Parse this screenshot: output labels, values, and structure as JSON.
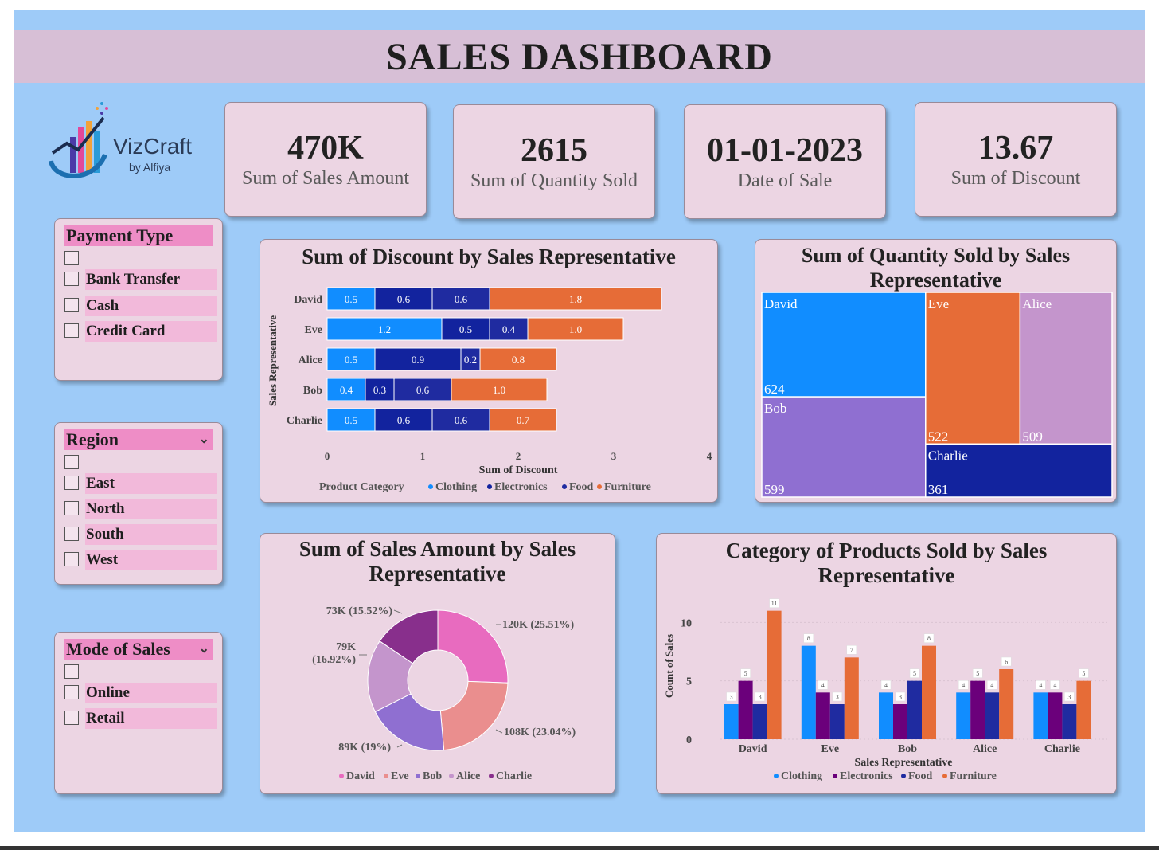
{
  "header": {
    "title": "SALES DASHBOARD"
  },
  "logo": {
    "name": "VizCraft",
    "byline": "by Alfiya"
  },
  "kpis": [
    {
      "value": "470K",
      "label": "Sum of Sales Amount"
    },
    {
      "value": "2615",
      "label": "Sum of Quantity Sold"
    },
    {
      "value": "01-01-2023",
      "label": "Date of Sale"
    },
    {
      "value": "13.67",
      "label": "Sum of Discount"
    }
  ],
  "slicers": {
    "payment": {
      "title": "Payment Type",
      "options": [
        "",
        "Bank Transfer",
        "Cash",
        "Credit Card"
      ]
    },
    "region": {
      "title": "Region",
      "options": [
        "",
        "East",
        "North",
        "South",
        "West"
      ]
    },
    "mode": {
      "title": "Mode of Sales",
      "options": [
        "",
        "Online",
        "Retail"
      ]
    }
  },
  "colors": {
    "clothing": "#118dff",
    "electronics": "#12239e",
    "food": "#1f2ba0",
    "furniture": "#e66c37",
    "bar_electronics": "#6b007b",
    "david": "#e86bbf",
    "eve": "#ea8e8e",
    "bob": "#8f6fd1",
    "alice": "#c495cc",
    "charlie": "#882f8c"
  },
  "chart_data": [
    {
      "type": "bar",
      "orientation": "horizontal",
      "stacked": true,
      "title": "Sum of Discount by Sales Representative",
      "xlabel": "Sum of Discount",
      "ylabel": "Sales Representative",
      "xlim": [
        0,
        4
      ],
      "xticks": [
        "0",
        "1",
        "2",
        "3",
        "4"
      ],
      "legend_title": "Product Category",
      "categories": [
        "David",
        "Eve",
        "Alice",
        "Bob",
        "Charlie"
      ],
      "series": [
        {
          "name": "Clothing",
          "values": [
            0.5,
            1.2,
            0.5,
            0.4,
            0.5
          ]
        },
        {
          "name": "Electronics",
          "values": [
            0.6,
            0.5,
            0.9,
            0.3,
            0.6
          ]
        },
        {
          "name": "Food",
          "values": [
            0.6,
            0.4,
            0.2,
            0.6,
            0.6
          ]
        },
        {
          "name": "Furniture",
          "values": [
            1.8,
            1.0,
            0.8,
            1.0,
            0.7
          ]
        }
      ]
    },
    {
      "type": "treemap",
      "title": "Sum of Quantity Sold by Sales Representative",
      "labels": [
        "David",
        "Bob",
        "Eve",
        "Alice",
        "Charlie"
      ],
      "values": [
        624,
        599,
        522,
        509,
        361
      ]
    },
    {
      "type": "pie",
      "donut": true,
      "title": "Sum of Sales Amount by Sales Representative",
      "labels": [
        "David",
        "Eve",
        "Bob",
        "Alice",
        "Charlie"
      ],
      "values": [
        120,
        108,
        89,
        79,
        73
      ],
      "slice_labels": [
        "120K (25.51%)",
        "108K (23.04%)",
        "89K (19%)",
        "79K (16.92%)",
        "73K (15.52%)"
      ]
    },
    {
      "type": "bar",
      "title": "Category of Products Sold by Sales Representative",
      "xlabel": "Sales Representative",
      "ylabel": "Count of Sales",
      "ylim": [
        0,
        12
      ],
      "yticks": [
        "0",
        "5",
        "10"
      ],
      "categories": [
        "David",
        "Eve",
        "Bob",
        "Alice",
        "Charlie"
      ],
      "series": [
        {
          "name": "Clothing",
          "values": [
            3,
            8,
            4,
            4,
            4
          ]
        },
        {
          "name": "Electronics",
          "values": [
            5,
            4,
            3,
            5,
            4
          ]
        },
        {
          "name": "Food",
          "values": [
            3,
            3,
            5,
            4,
            3
          ]
        },
        {
          "name": "Furniture",
          "values": [
            11,
            7,
            8,
            6,
            5
          ]
        }
      ]
    }
  ]
}
